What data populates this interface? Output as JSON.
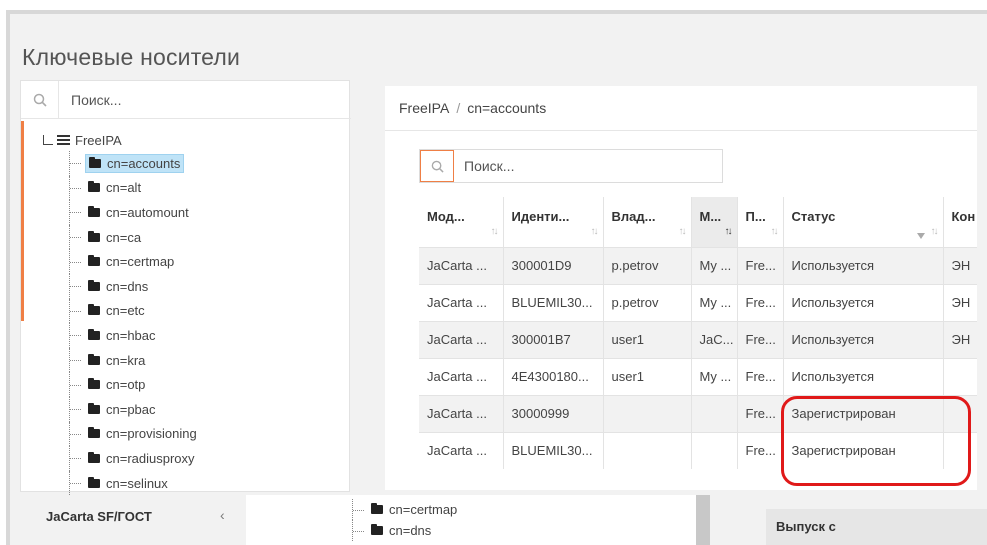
{
  "page_title": "Ключевые носители",
  "left_search": {
    "placeholder": "Поиск..."
  },
  "tree": {
    "root": "FreeIPA",
    "items": [
      {
        "label": "cn=accounts",
        "selected": true
      },
      {
        "label": "cn=alt"
      },
      {
        "label": "cn=automount"
      },
      {
        "label": "cn=ca"
      },
      {
        "label": "cn=certmap"
      },
      {
        "label": "cn=dns"
      },
      {
        "label": "cn=etc"
      },
      {
        "label": "cn=hbac"
      },
      {
        "label": "cn=kra"
      },
      {
        "label": "cn=otp"
      },
      {
        "label": "cn=pbac"
      },
      {
        "label": "cn=provisioning"
      },
      {
        "label": "cn=radiusproxy"
      },
      {
        "label": "cn=selinux"
      }
    ]
  },
  "bottom_nav": {
    "label": "JaCarta SF/ГОСТ",
    "chevron": "‹"
  },
  "bottom_tree": [
    "cn=certmap",
    "cn=dns"
  ],
  "bottom_right": {
    "label": "Выпуск с"
  },
  "breadcrumb": {
    "root": "FreeIPA",
    "separator": "/",
    "current": "cn=accounts"
  },
  "table_search": {
    "placeholder": "Поиск..."
  },
  "table": {
    "columns": [
      "Мод...",
      "Иденти...",
      "Влад...",
      "М...",
      "П...",
      "Статус",
      "Кон"
    ],
    "rows": [
      [
        "JaCarta ...",
        "300001D9",
        "p.petrov",
        "My ...",
        "Fre...",
        "Используется",
        "ЭН"
      ],
      [
        "JaCarta ...",
        "BLUEMIL30...",
        "p.petrov",
        "My ...",
        "Fre...",
        "Используется",
        "ЭН"
      ],
      [
        "JaCarta ...",
        "300001B7",
        "user1",
        "JaC...",
        "Fre...",
        "Используется",
        "ЭН"
      ],
      [
        "JaCarta ...",
        "4E4300180...",
        "user1",
        "My ...",
        "Fre...",
        "Используется",
        ""
      ],
      [
        "JaCarta ...",
        "30000999",
        "",
        "",
        "Fre...",
        "Зарегистрирован",
        ""
      ],
      [
        "JaCarta ...",
        "BLUEMIL30...",
        "",
        "",
        "Fre...",
        "Зарегистрирован",
        ""
      ]
    ]
  },
  "colors": {
    "accent": "#ef7f45",
    "selection": "#bfe3f7",
    "annotation": "#e01919"
  }
}
